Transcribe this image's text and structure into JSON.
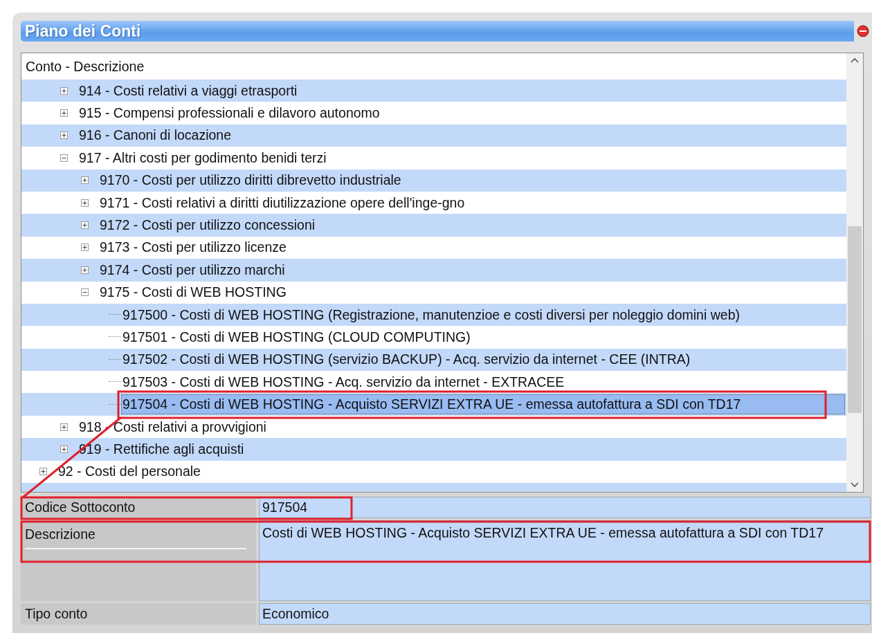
{
  "window": {
    "title": "Piano dei Conti"
  },
  "tree": {
    "header": "Conto - Descrizione",
    "items": [
      {
        "children": [
          {
            "label": "914 - Costi relativi a viaggi etrasporti",
            "expanded": false,
            "selected": false
          },
          {
            "label": "915 - Compensi professionali e dilavoro autonomo",
            "expanded": false,
            "selected": false
          },
          {
            "label": "916 - Canoni di locazione",
            "expanded": false,
            "selected": false
          },
          {
            "label": "917 - Altri costi per godimento benidi terzi",
            "expanded": true,
            "selected": false,
            "children": [
              {
                "label": "9170 - Costi per utilizzo diritti dibrevetto industriale",
                "expanded": false,
                "selected": false
              },
              {
                "label": "9171 - Costi relativi a diritti diutilizzazione opere dell'inge-gno",
                "expanded": false,
                "selected": false
              },
              {
                "label": "9172 - Costi per utilizzo concessioni",
                "expanded": false,
                "selected": false
              },
              {
                "label": "9173 - Costi per utilizzo licenze",
                "expanded": false,
                "selected": false
              },
              {
                "label": "9174 - Costi per utilizzo marchi",
                "expanded": false,
                "selected": false
              },
              {
                "label": "9175 - Costi di WEB HOSTING",
                "expanded": true,
                "selected": false,
                "children": [
                  {
                    "label": "917500 - Costi di WEB HOSTING (Registrazione, manutenzioe e costi diversi per noleggio domini web)",
                    "selected": false
                  },
                  {
                    "label": "917501 - Costi di WEB HOSTING (CLOUD COMPUTING)",
                    "selected": false
                  },
                  {
                    "label": "917502 - Costi di WEB HOSTING (servizio BACKUP) -  Acq. servizio da internet - CEE (INTRA)",
                    "selected": false
                  },
                  {
                    "label": "917503 - Costi di WEB HOSTING -  Acq. servizio da internet - EXTRACEE",
                    "selected": false
                  },
                  {
                    "label": "917504 - Costi di WEB HOSTING - Acquisto SERVIZI EXTRA UE - emessa autofattura a SDI con TD17",
                    "selected": true
                  }
                ]
              }
            ]
          },
          {
            "label": "918 - Costi relativi a provvigioni",
            "expanded": false,
            "selected": false
          },
          {
            "label": "919 - Rettifiche agli acquisti",
            "expanded": false,
            "selected": false
          }
        ]
      },
      {
        "label": "92 - Costi del personale",
        "expanded": false,
        "selected": false
      }
    ]
  },
  "form": [
    {
      "kind": "line",
      "label": "Codice Sottoconto",
      "value": "917504"
    },
    {
      "kind": "multiline",
      "label": "Descrizione",
      "value": "Costi di WEB HOSTING - Acquisto SERVIZI EXTRA UE - emessa autofattura a SDI con TD17"
    },
    {
      "kind": "line",
      "label": "Tipo conto",
      "value": "Economico"
    }
  ]
}
